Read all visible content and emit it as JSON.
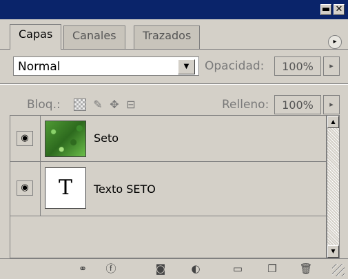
{
  "window": {
    "minimize_glyph": "▬",
    "close_glyph": "✕"
  },
  "tabs": [
    {
      "label": "Capas",
      "active": true
    },
    {
      "label": "Canales",
      "active": false
    },
    {
      "label": "Trazados",
      "active": false
    }
  ],
  "panel_menu_glyph": "▸",
  "blend": {
    "mode": "Normal",
    "arrow": "▼"
  },
  "opacity": {
    "label": "Opacidad:",
    "value": "100%",
    "arrow": "▸"
  },
  "lock": {
    "label": "Bloq.:",
    "icons": [
      "lock-transparent-icon",
      "brush-icon",
      "move-icon",
      "padlock-icon"
    ]
  },
  "fill": {
    "label": "Relleno:",
    "value": "100%",
    "arrow": "▸"
  },
  "layers": [
    {
      "name": "Seto",
      "thumb": "grass-image",
      "visible": true
    },
    {
      "name": "Texto SETO",
      "thumb_text": "T",
      "visible": true
    }
  ],
  "bottom_icons": [
    "link-icon",
    "fx-icon",
    "mask-icon",
    "adjustment-icon",
    "folder-icon",
    "new-layer-icon",
    "trash-icon"
  ]
}
